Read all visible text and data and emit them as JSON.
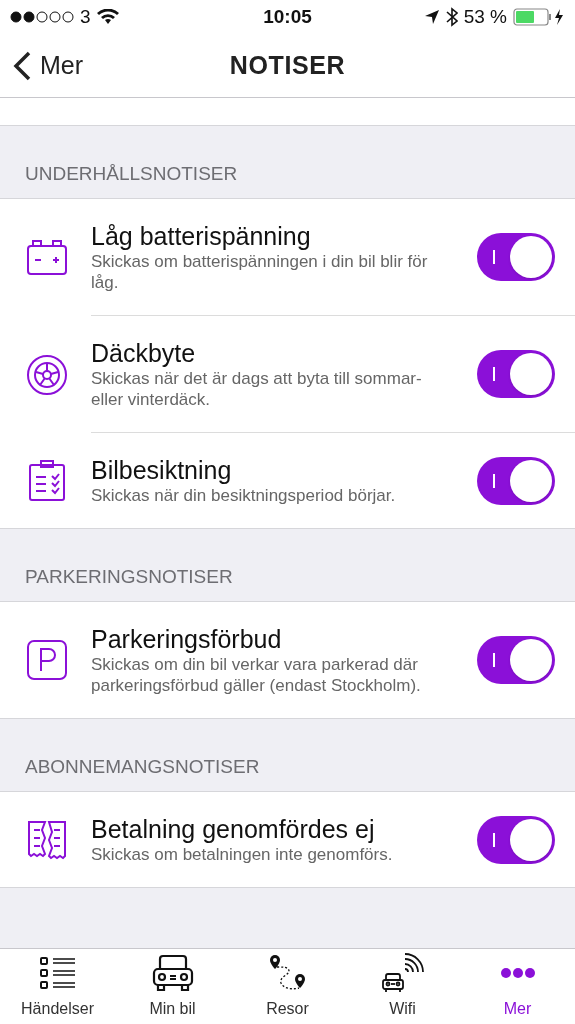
{
  "status_bar": {
    "carrier": "3",
    "time": "10:05",
    "battery": "53 %"
  },
  "nav": {
    "back": "Mer",
    "title": "NOTISER"
  },
  "sections": [
    {
      "title": "UNDERHÅLLSNOTISER",
      "items": [
        {
          "kind": "battery",
          "title": "Låg batterispänning",
          "description": "Skickas om batterispänningen i din bil blir för låg.",
          "on": true
        },
        {
          "kind": "tire",
          "title": "Däckbyte",
          "description": "Skickas när det är dags att byta till sommar- eller vinterdäck.",
          "on": true
        },
        {
          "kind": "clipboard",
          "title": "Bilbesiktning",
          "description": "Skickas när din besiktningsperiod börjar.",
          "on": true
        }
      ]
    },
    {
      "title": "PARKERINGSNOTISER",
      "items": [
        {
          "kind": "parking",
          "title": "Parkeringsförbud",
          "description": "Skickas om din bil verkar vara parkerad där parkeringsförbud gäller (endast Stockholm).",
          "on": true
        }
      ]
    },
    {
      "title": "ABONNEMANGSNOTISER",
      "items": [
        {
          "kind": "receipt",
          "title": "Betalning genomfördes ej",
          "description": "Skickas om betalningen inte genomförs.",
          "on": true
        }
      ]
    }
  ],
  "tabs": [
    {
      "kind": "list",
      "label": "Händelser",
      "selected": false
    },
    {
      "kind": "car",
      "label": "Min bil",
      "selected": false
    },
    {
      "kind": "route",
      "label": "Resor",
      "selected": false
    },
    {
      "kind": "wifi",
      "label": "Wifi",
      "selected": false
    },
    {
      "kind": "more",
      "label": "Mer",
      "selected": true
    }
  ]
}
